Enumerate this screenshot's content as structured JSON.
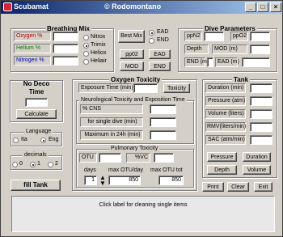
{
  "window": {
    "title": "Scubamat",
    "author": "© Rodomontano",
    "minimize": "_",
    "maximize": "□",
    "close": "×"
  },
  "breathing_mix": {
    "title": "Breathing Mix",
    "oxygen": "Oxygen  %",
    "helium": "Helium  %",
    "nitrogen": "Nitrogen  %",
    "mix_options": [
      "Nitrox",
      "Trimix",
      "Heliox",
      "Heliair"
    ],
    "selected_mix": "Trimix",
    "best_mix": "Best Mix",
    "ead_options": [
      "EAD",
      "END"
    ],
    "selected_ead": "EAD",
    "pp02": "pp02",
    "ead_btn": "EAD",
    "mod": "MOD",
    "end_btn": "END"
  },
  "dive_parameters": {
    "title": "Dive Parameters",
    "ppn2": "ppN2",
    "ppo2": "ppO2",
    "depth": "Depth",
    "mod": "MOD (m)",
    "end": "END (m)",
    "ead": "EAD  (m)"
  },
  "no_deco": {
    "title": "No Deco Time",
    "calculate": "Calculate"
  },
  "language": {
    "title": "Language",
    "options": [
      "Ita",
      "Eng"
    ],
    "selected": "Eng"
  },
  "decimals": {
    "title": "decimals",
    "options": [
      "0",
      "1",
      "2"
    ],
    "selected": "1"
  },
  "fill_tank": "fill Tank",
  "oxygen_toxicity": {
    "title": "Oxygen Toxicity",
    "exposure_time": "Exposure Time (min)",
    "toxicity_btn": "Toxicity",
    "neuro_title": "Neurological Toxicity and Exposition Time",
    "cns": "% CNS",
    "single_dive": "for single dive  (min)",
    "max_24h": "Maximum in 24h  (min)",
    "pulmonary_title": "Pulmonary Toxicity",
    "otu": "OTU",
    "vc": "%VC",
    "days_label": "days",
    "days_value": "1",
    "max_otu_day": "max OTU/day",
    "max_otu_day_value": "850",
    "max_otu_tot": "max OTU tot",
    "max_otu_tot_value": "850"
  },
  "tank": {
    "title": "Tank",
    "duration": "Duration (min)",
    "pressure": "Pressure (atm)",
    "volume": "Volume (liters)",
    "rmv": "RMV(liters/min)",
    "sac": "SAC (atm/min)",
    "pressure_btn": "Pressure",
    "duration_btn": "Duration",
    "depth_btn": "Depth",
    "volume_btn": "Volume"
  },
  "actions": {
    "print": "Print",
    "clear": "Clear",
    "exit": "Exit"
  },
  "status": "Click label for cleaning single items"
}
